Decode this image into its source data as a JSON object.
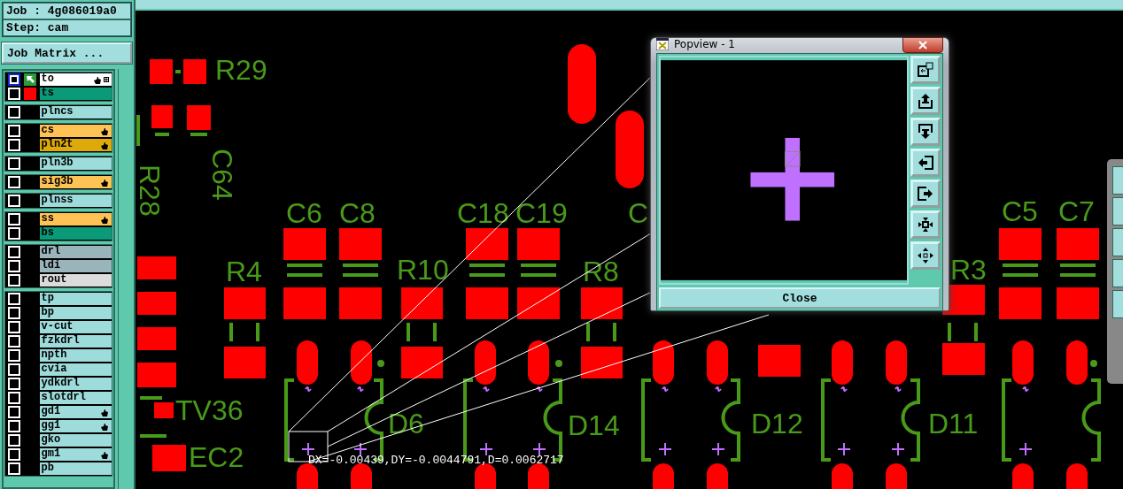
{
  "job_panel": {
    "job": "Job : 4g086019a0",
    "step": "Step: cam",
    "job_matrix_button": "Job Matrix ..."
  },
  "layer_groups": [
    {
      "layers": [
        {
          "name": "to",
          "color": "#ffffff",
          "work": true,
          "displayed": false,
          "affected": true
        },
        {
          "name": "ts",
          "color": "#0a9a78",
          "work": false,
          "displayed": true,
          "affected": false
        }
      ]
    },
    {
      "layers": [
        {
          "name": "plncs",
          "color": "#9edbdb",
          "work": false,
          "displayed": false,
          "affected": false
        }
      ]
    },
    {
      "layers": [
        {
          "name": "cs",
          "color": "#ffc355",
          "work": false,
          "displayed": false,
          "affected": true
        },
        {
          "name": "pln2t",
          "color": "#deaa0a",
          "work": false,
          "displayed": false,
          "affected": true
        }
      ]
    },
    {
      "layers": [
        {
          "name": "pln3b",
          "color": "#9edbdb",
          "work": false,
          "displayed": false,
          "affected": false
        }
      ]
    },
    {
      "layers": [
        {
          "name": "sig3b",
          "color": "#ffc355",
          "work": false,
          "displayed": false,
          "affected": true
        }
      ]
    },
    {
      "layers": [
        {
          "name": "plnss",
          "color": "#9edbdb",
          "work": false,
          "displayed": false,
          "affected": false
        }
      ]
    },
    {
      "layers": [
        {
          "name": "ss",
          "color": "#ffc355",
          "work": false,
          "displayed": false,
          "affected": true
        },
        {
          "name": "bs",
          "color": "#0a9a78",
          "work": false,
          "displayed": false,
          "affected": false
        }
      ]
    },
    {
      "layers": [
        {
          "name": "drl",
          "color": "#9ab4bc",
          "work": false,
          "displayed": false,
          "affected": false
        },
        {
          "name": "ldi",
          "color": "#9ab4bc",
          "work": false,
          "displayed": false,
          "affected": false
        },
        {
          "name": "rout",
          "color": "#dcdcdc",
          "work": false,
          "displayed": false,
          "affected": false
        }
      ]
    },
    {
      "layers": [
        {
          "name": "tp",
          "color": "#9edbdb",
          "work": false,
          "displayed": false,
          "affected": false
        },
        {
          "name": "bp",
          "color": "#9edbdb",
          "work": false,
          "displayed": false,
          "affected": false
        },
        {
          "name": "v-cut",
          "color": "#9edbdb",
          "work": false,
          "displayed": false,
          "affected": false
        },
        {
          "name": "fzkdrl",
          "color": "#9edbdb",
          "work": false,
          "displayed": false,
          "affected": false
        },
        {
          "name": "npth",
          "color": "#9edbdb",
          "work": false,
          "displayed": false,
          "affected": false
        },
        {
          "name": "cvia",
          "color": "#9edbdb",
          "work": false,
          "displayed": false,
          "affected": false
        },
        {
          "name": "ydkdrl",
          "color": "#9edbdb",
          "work": false,
          "displayed": false,
          "affected": false
        },
        {
          "name": "slotdrl",
          "color": "#9edbdb",
          "work": false,
          "displayed": false,
          "affected": false
        },
        {
          "name": "gd1",
          "color": "#9edbdb",
          "work": false,
          "displayed": false,
          "affected": true
        },
        {
          "name": "gg1",
          "color": "#9edbdb",
          "work": false,
          "displayed": false,
          "affected": true
        },
        {
          "name": "gko",
          "color": "#9edbdb",
          "work": false,
          "displayed": false,
          "affected": false
        },
        {
          "name": "gm1",
          "color": "#9edbdb",
          "work": false,
          "displayed": false,
          "affected": true
        },
        {
          "name": "pb",
          "color": "#9edbdb",
          "work": false,
          "displayed": false,
          "affected": false
        }
      ]
    }
  ],
  "board": {
    "silkscreen_labels": [
      "R29",
      "R28",
      "C64",
      "C6",
      "C8",
      "C18",
      "C19",
      "C",
      "R4",
      "R10",
      "R8",
      "R3",
      "C5",
      "C7",
      "D6",
      "D14",
      "D12",
      "D11",
      "TV36",
      "EC2"
    ],
    "measurement": "DX=-0.00439,DY=-0.0044791,D=0.0062717"
  },
  "popview": {
    "title": "Popview - 1",
    "close_button": "Close"
  }
}
